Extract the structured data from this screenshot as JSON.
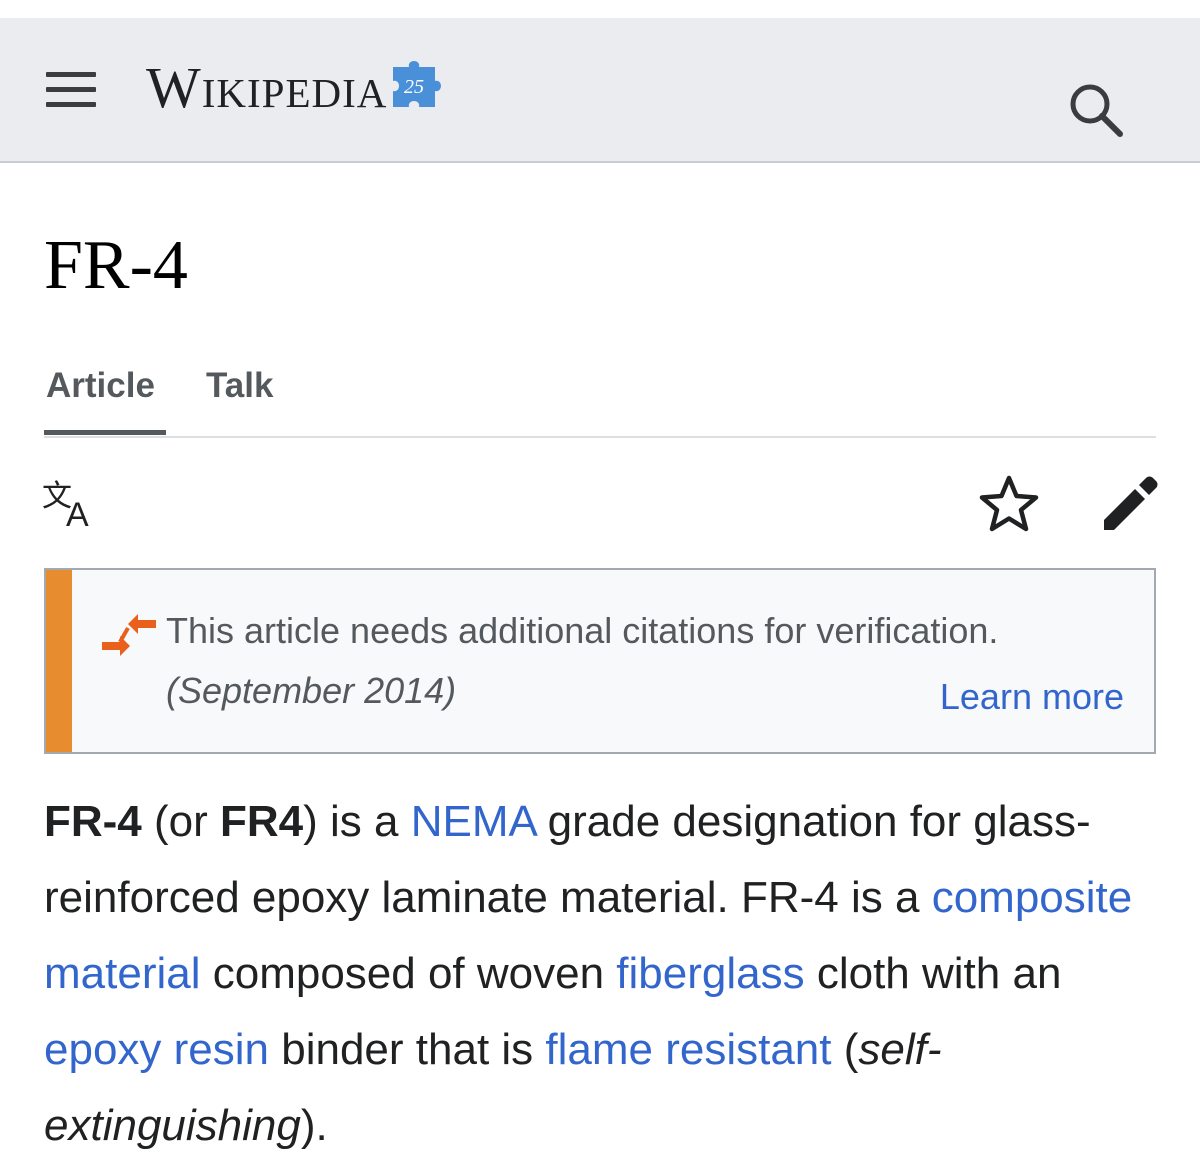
{
  "header": {
    "logo_text": "Wikipedia",
    "logo_badge": "25"
  },
  "page": {
    "title": "FR-4"
  },
  "tabs": [
    {
      "label": "Article",
      "active": true
    },
    {
      "label": "Talk",
      "active": false
    }
  ],
  "icons": {
    "menu": "hamburger-menu-icon",
    "search": "search-icon",
    "language": "language-icon",
    "watch": "star-icon",
    "edit": "pencil-icon",
    "notice": "citation-arrows-icon"
  },
  "notice": {
    "text": "This article needs additional citations for verification.",
    "date": "(September 2014)",
    "learn_more": "Learn more",
    "accent_color": "#e88d2f"
  },
  "article": {
    "p1_bold1": "FR-4",
    "p1_t1": " (or ",
    "p1_bold2": "FR4",
    "p1_t2": ") is a ",
    "link_nema": "NEMA",
    "p1_t3": " grade designation for glass-reinforced epoxy laminate material. FR-4 is a ",
    "link_composite": "composite material",
    "p1_t4": " composed of woven ",
    "link_fiberglass": "fiberglass",
    "p1_t5": " cloth with an ",
    "link_epoxy": "epoxy resin",
    "p1_t6": " binder that is ",
    "link_flame": "flame resistant",
    "p1_t7": " (",
    "p1_italic": "self-extinguishing",
    "p1_t8": ")."
  },
  "colors": {
    "link": "#3366cc",
    "header_bg": "#eaecf0",
    "text": "#202122"
  }
}
